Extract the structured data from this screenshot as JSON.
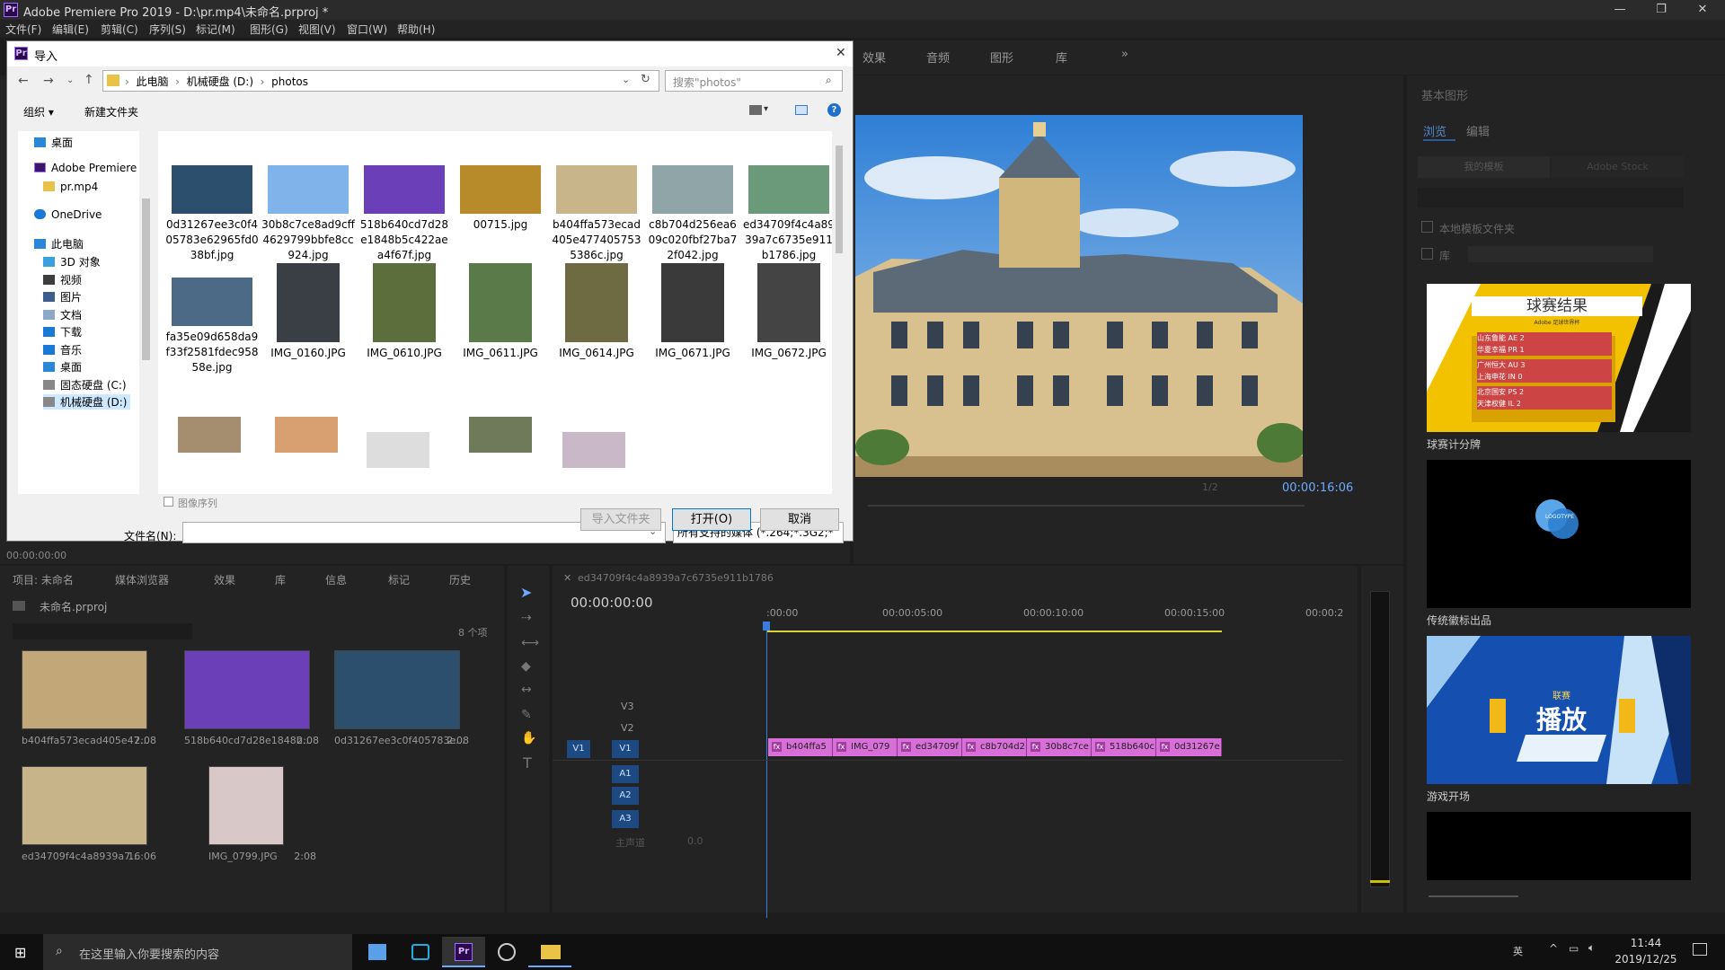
{
  "window": {
    "title": "Adobe Premiere Pro 2019 - D:\\pr.mp4\\未命名.prproj *",
    "logo": "Pr"
  },
  "menu": [
    "文件(F)",
    "编辑(E)",
    "剪辑(C)",
    "序列(S)",
    "标记(M)",
    "图形(G)",
    "视图(V)",
    "窗口(W)",
    "帮助(H)"
  ],
  "workspace_tabs": [
    "效果",
    "音频",
    "图形",
    "库"
  ],
  "dialog": {
    "title": "导入",
    "breadcrumb": [
      "此电脑",
      "机械硬盘 (D:)",
      "photos"
    ],
    "search_placeholder": "搜索\"photos\"",
    "organize": "组织 ▾",
    "new_folder": "新建文件夹",
    "nav_items": [
      {
        "label": "桌面",
        "icon": "desktop-icon"
      },
      {
        "label": "Adobe Premiere",
        "icon": "premiere-icon"
      },
      {
        "label": "pr.mp4",
        "icon": "folder-icon"
      },
      {
        "label": "OneDrive",
        "icon": "onedrive-icon"
      },
      {
        "label": "此电脑",
        "icon": "computer-icon"
      },
      {
        "label": "3D 对象",
        "icon": "cube-icon"
      },
      {
        "label": "视频",
        "icon": "video-icon"
      },
      {
        "label": "图片",
        "icon": "picture-icon"
      },
      {
        "label": "文档",
        "icon": "document-icon"
      },
      {
        "label": "下载",
        "icon": "download-icon"
      },
      {
        "label": "音乐",
        "icon": "music-icon"
      },
      {
        "label": "桌面",
        "icon": "desktop-icon"
      },
      {
        "label": "固态硬盘 (C:)",
        "icon": "drive-icon"
      },
      {
        "label": "机械硬盘 (D:)",
        "icon": "drive-icon"
      }
    ],
    "files": [
      {
        "name": "0d31267ee3c0f405783e62965fd038bf.jpg",
        "color": "#2c4f6e"
      },
      {
        "name": "30b8c7ce8ad9cff4629799bbfe8cc924.jpg",
        "color": "#7fb3ea"
      },
      {
        "name": "518b640cd7d28e1848b5c422aea4f67f.jpg",
        "color": "#6a3fb8"
      },
      {
        "name": "00715.jpg",
        "color": "#b78a2a"
      },
      {
        "name": "b404ffa573ecad405e4774057535386c.jpg",
        "color": "#c9b58a"
      },
      {
        "name": "c8b704d256ea609c020fbf27ba72f042.jpg",
        "color": "#8fa5a8"
      },
      {
        "name": "ed34709f4c4a8939a7c6735e911b1786.jpg",
        "color": "#6a9a7a"
      },
      {
        "name": "fa35e09d658da9f33f2581fdec95858e.jpg",
        "color": "#4c6a86"
      },
      {
        "name": "IMG_0160.JPG",
        "color": "#3a3e45"
      },
      {
        "name": "IMG_0610.JPG",
        "color": "#5b6e3c"
      },
      {
        "name": "IMG_0611.JPG",
        "color": "#5a7a4a"
      },
      {
        "name": "IMG_0614.JPG",
        "color": "#6e6a42"
      },
      {
        "name": "IMG_0671.JPG",
        "color": "#3a3a3a"
      },
      {
        "name": "IMG_0672.JPG",
        "color": "#444444"
      }
    ],
    "image_sequence": "图像序列",
    "filename_label": "文件名(N):",
    "filename_value": "",
    "filetype": "所有支持的媒体 (*.264;*.3G2;*",
    "btn_import_folder": "导入文件夹",
    "btn_open": "打开(O)",
    "btn_cancel": "取消"
  },
  "source_timecode": "00:00:00:00",
  "program": {
    "timecode": "00:00:16:06",
    "zoom": "1/2"
  },
  "project": {
    "tabs": [
      "项目: 未命名",
      "媒体浏览器",
      "效果",
      "库",
      "信息",
      "标记",
      "历史"
    ],
    "file": "未命名.prproj",
    "count": "8 个项",
    "items": [
      {
        "name": "b404ffa573ecad405e47...",
        "dur": "2:08",
        "color": "#c2a878"
      },
      {
        "name": "518b640cd7d28e1848b...",
        "dur": "2:08",
        "color": "#6a3fb8"
      },
      {
        "name": "0d31267ee3c0f405783e...",
        "dur": "2:08",
        "color": "#2c4f6e"
      },
      {
        "name": "ed34709f4c4a8939a7...",
        "dur": "16:06",
        "color": "#c7b489"
      },
      {
        "name": "IMG_0799.JPG",
        "dur": "2:08",
        "color": "#d8c8c8"
      }
    ]
  },
  "timeline": {
    "seq_name": "ed34709f4c4a8939a7c6735e911b1786",
    "timecode": "00:00:00:00",
    "ruler": [
      ":00:00",
      "00:00:05:00",
      "00:00:10:00",
      "00:00:15:00",
      "00:00:2"
    ],
    "tracks": [
      "V3",
      "V2",
      "V1",
      "A1",
      "A2",
      "A3"
    ],
    "master": "主声道",
    "master_val": "0.0",
    "clips": [
      "b404ffa5",
      "IMG_079",
      "ed34709f",
      "c8b704d2",
      "30b8c7ce",
      "518b640c",
      "0d31267e"
    ]
  },
  "essential_graphics": {
    "title": "基本图形",
    "tabs": [
      "浏览",
      "编辑"
    ],
    "btn_templates": "我的模板",
    "btn_stock": "Adobe Stock",
    "chk_local": "本地模板文件夹",
    "chk_lib": "库",
    "items": [
      {
        "label": "球赛计分牌",
        "title": "球赛结果",
        "sub": "Adobe 足球世界杯",
        "rows": [
          "山东鲁能 AE 2",
          "华夏幸福 PR 1",
          "广州恒大 AU 3",
          "上海申花 IN 0",
          "北京国安 PS 2",
          "天津权健 IL 2"
        ]
      },
      {
        "label": "传统徽标出品",
        "logo": "LOGOTYPE"
      },
      {
        "label": "游戏开场",
        "big": "播放",
        "small": "联赛"
      }
    ]
  },
  "taskbar": {
    "search_placeholder": "在这里输入你要搜索的内容",
    "ime": "英",
    "time": "11:44",
    "date": "2019/12/25"
  }
}
